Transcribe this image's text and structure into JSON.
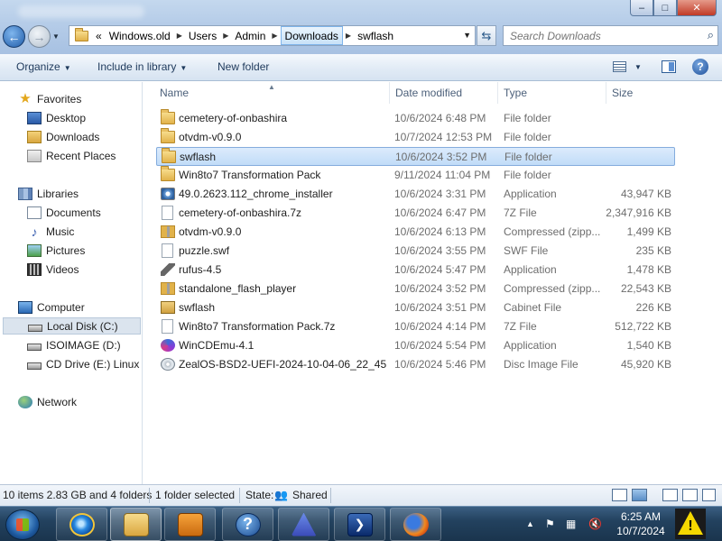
{
  "window": {
    "buttons": {
      "minimize": "–",
      "maximize": "□",
      "close": "✕"
    }
  },
  "address": {
    "overflow": "«",
    "crumbs": [
      "Windows.old",
      "Users",
      "Admin",
      "Downloads",
      "swflash"
    ]
  },
  "search": {
    "placeholder": "Search Downloads"
  },
  "toolbar": {
    "organize": "Organize",
    "include_in_library": "Include in library",
    "new_folder": "New folder"
  },
  "nav": {
    "favorites": "Favorites",
    "desktop": "Desktop",
    "downloads": "Downloads",
    "recent_places": "Recent Places",
    "libraries": "Libraries",
    "documents": "Documents",
    "music": "Music",
    "pictures": "Pictures",
    "videos": "Videos",
    "computer": "Computer",
    "local_disk": "Local Disk (C:)",
    "isoimage": "ISOIMAGE (D:)",
    "cd_drive": "CD Drive (E:) Linux M",
    "network": "Network"
  },
  "columns": {
    "name": "Name",
    "date": "Date modified",
    "type": "Type",
    "size": "Size"
  },
  "files": [
    {
      "name": "cemetery-of-onbashira",
      "date": "10/6/2024 6:48 PM",
      "type": "File folder",
      "size": "",
      "icon": "folder-icon"
    },
    {
      "name": "otvdm-v0.9.0",
      "date": "10/7/2024 12:53 PM",
      "type": "File folder",
      "size": "",
      "icon": "folder-icon"
    },
    {
      "name": "swflash",
      "date": "10/6/2024 3:52 PM",
      "type": "File folder",
      "size": "",
      "icon": "folder-icon"
    },
    {
      "name": "Win8to7 Transformation Pack",
      "date": "9/11/2024 11:04 PM",
      "type": "File folder",
      "size": "",
      "icon": "folder-icon"
    },
    {
      "name": "49.0.2623.112_chrome_installer",
      "date": "10/6/2024 3:31 PM",
      "type": "Application",
      "size": "43,947 KB",
      "icon": "application-icon"
    },
    {
      "name": "cemetery-of-onbashira.7z",
      "date": "10/6/2024 6:47 PM",
      "type": "7Z File",
      "size": "2,347,916 KB",
      "icon": "file-icon"
    },
    {
      "name": "otvdm-v0.9.0",
      "date": "10/6/2024 6:13 PM",
      "type": "Compressed (zipp...",
      "size": "1,499 KB",
      "icon": "zip-folder-icon"
    },
    {
      "name": "puzzle.swf",
      "date": "10/6/2024 3:55 PM",
      "type": "SWF File",
      "size": "235 KB",
      "icon": "file-icon"
    },
    {
      "name": "rufus-4.5",
      "date": "10/6/2024 5:47 PM",
      "type": "Application",
      "size": "1,478 KB",
      "icon": "usb-icon"
    },
    {
      "name": "standalone_flash_player",
      "date": "10/6/2024 3:52 PM",
      "type": "Compressed (zipp...",
      "size": "22,543 KB",
      "icon": "zip-folder-icon"
    },
    {
      "name": "swflash",
      "date": "10/6/2024 3:51 PM",
      "type": "Cabinet File",
      "size": "226 KB",
      "icon": "cabinet-icon"
    },
    {
      "name": "Win8to7 Transformation Pack.7z",
      "date": "10/6/2024 4:14 PM",
      "type": "7Z File",
      "size": "512,722 KB",
      "icon": "file-icon"
    },
    {
      "name": "WinCDEmu-4.1",
      "date": "10/6/2024 5:54 PM",
      "type": "Application",
      "size": "1,540 KB",
      "icon": "wincdemu-icon"
    },
    {
      "name": "ZealOS-BSD2-UEFI-2024-10-04-06_22_45",
      "date": "10/6/2024 5:46 PM",
      "type": "Disc Image File",
      "size": "45,920 KB",
      "icon": "disc-image-icon"
    }
  ],
  "status": {
    "items": "10 items 2.83 GB and 4 folders",
    "selected": "1 folder selected",
    "state_label": "State:",
    "state_value": "Shared"
  },
  "taskbar": {
    "time": "6:25 AM",
    "date": "10/7/2024"
  }
}
